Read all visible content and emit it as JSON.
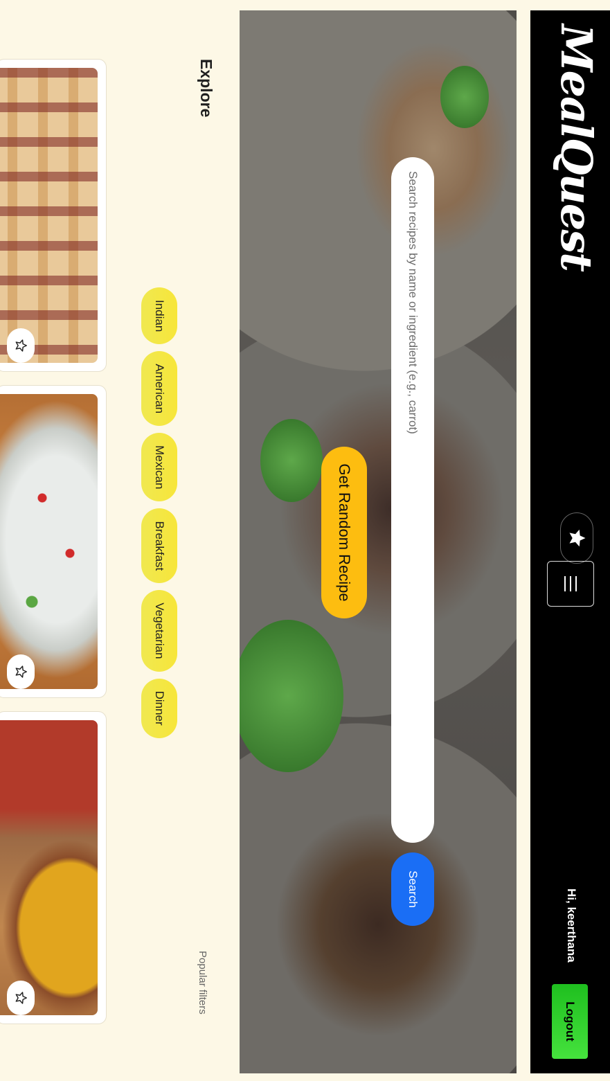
{
  "navbar": {
    "brand": "MealQuest",
    "greeting": "Hi, keerthana",
    "logout_label": "Logout",
    "favorites_icon": "star-icon",
    "menu_icon": "hamburger-icon"
  },
  "hero": {
    "search_placeholder": "Search recipes by name or ingredient (e.g., carrot)",
    "search_value": "",
    "search_label": "Search",
    "random_label": "Get Random Recipe"
  },
  "explore": {
    "title": "Explore",
    "popular_filters_label": "Popular filters",
    "filters": [
      "Indian",
      "American",
      "Mexican",
      "Breakfast",
      "Vegetarian",
      "Dinner"
    ]
  },
  "cards": [
    {
      "favorite_icon": "star-outline-icon"
    },
    {
      "favorite_icon": "star-outline-icon"
    },
    {
      "favorite_icon": "star-outline-icon"
    }
  ],
  "colors": {
    "page_bg": "#fdf8e6",
    "navbar_bg": "#000000",
    "search_button": "#1a6ef5",
    "random_button": "#fdbd10",
    "chip": "#f4e63f",
    "logout_button": "#2ecc2e"
  }
}
